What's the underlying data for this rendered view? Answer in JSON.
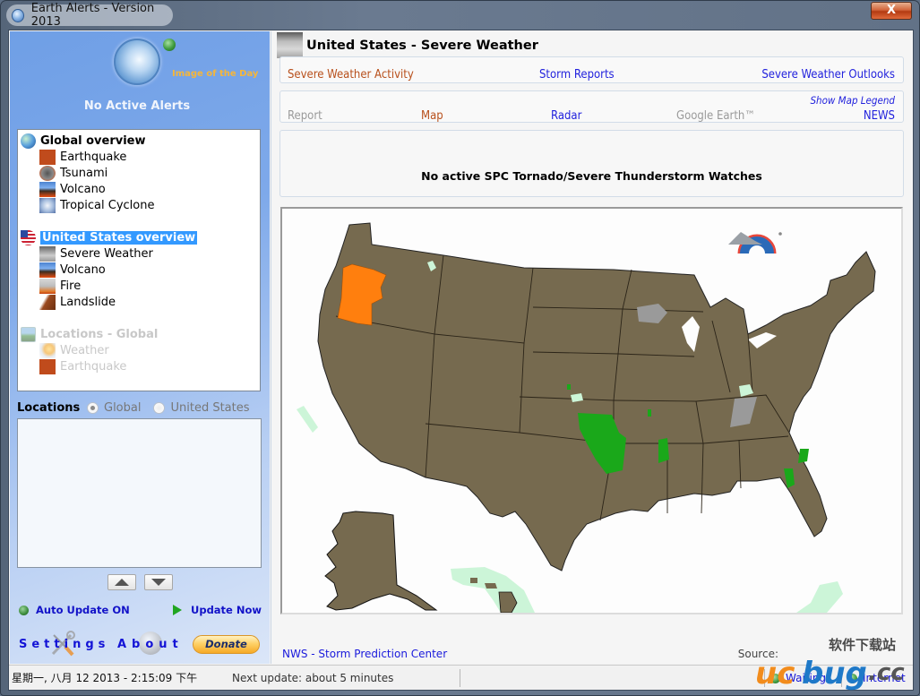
{
  "window": {
    "title": "Earth Alerts - Version 2013",
    "close_label": "X"
  },
  "sidebar": {
    "image_of_day": "Image of the Day",
    "alert_status": "No Active Alerts",
    "tree": {
      "global": {
        "label": "Global overview",
        "items": [
          "Earthquake",
          "Tsunami",
          "Volcano",
          "Tropical Cyclone"
        ]
      },
      "us": {
        "label": "United States overview",
        "items": [
          "Severe Weather",
          "Volcano",
          "Fire",
          "Landslide"
        ]
      },
      "locations_global": {
        "label": "Locations - Global",
        "items": [
          "Weather",
          "Earthquake"
        ]
      }
    },
    "locations": {
      "title": "Locations",
      "options": [
        "Global",
        "United States"
      ],
      "selected": "Global"
    },
    "auto_update": "Auto Update ON",
    "update_now": "Update Now",
    "settings": "Settings",
    "about": "About",
    "donate": "Donate"
  },
  "main": {
    "section_title": "United States - Severe Weather",
    "tabs_top": [
      "Severe Weather Activity",
      "Storm Reports",
      "Severe Weather Outlooks"
    ],
    "show_legend": "Show Map Legend",
    "tabs_view": [
      "Report",
      "Map",
      "Radar",
      "Google Earth™",
      "NEWS"
    ],
    "watches_message": "No active SPC Tornado/Severe Thunderstorm Watches",
    "footer_link": "NWS - Storm Prediction Center",
    "source_label": "Source:",
    "map_colors": {
      "land": "#766a4f",
      "fire_weather": "#ff7f0e",
      "severe_tstorm": "#1aa81a",
      "flood_watch": "#ccf5d8",
      "gray_advisory": "#9a9a9a"
    }
  },
  "statusbar": {
    "datetime": "星期一, 八月 12 2013 - 2:15:09 下午",
    "next_update": "Next update: about 5 minutes",
    "status": "Waiting...",
    "connection": "Internet"
  },
  "watermark": {
    "text": "ucbug.cc",
    "cn": "软件下载站"
  }
}
